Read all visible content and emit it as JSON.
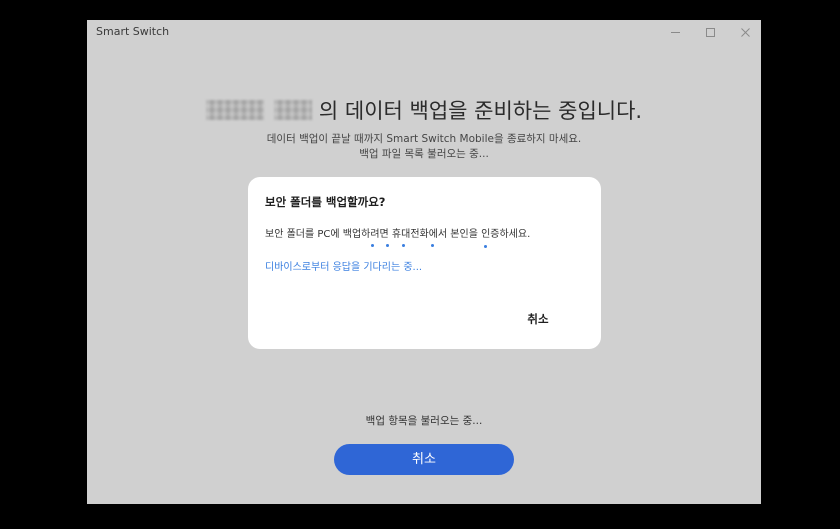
{
  "window": {
    "title": "Smart Switch"
  },
  "controls": {
    "minimize": "minimize-icon",
    "maximize": "maximize-icon",
    "close": "close-icon"
  },
  "main": {
    "headline": "의 데이터 백업을 준비하는 중입니다.",
    "subtext_1": "데이터 백업이 끝날 때까지 Smart Switch Mobile을 종료하지 마세요.",
    "subtext_2": "백업 파일 목록 불러오는 중..."
  },
  "dialog": {
    "title": "보안 폴더를 백업할까요?",
    "message": "보안 폴더를 PC에 백업하려면 휴대전화에서 본인을 인증하세요.",
    "status": "디바이스로부터 응답을 기다리는 중...",
    "cancel_label": "취소"
  },
  "footer": {
    "status": "백업 항목을 불러오는 중...",
    "cancel_label": "취소"
  },
  "colors": {
    "accent": "#2f66d6",
    "link": "#3a7fe0",
    "window_bg": "#d0d0d0",
    "dialog_bg": "#ffffff"
  }
}
